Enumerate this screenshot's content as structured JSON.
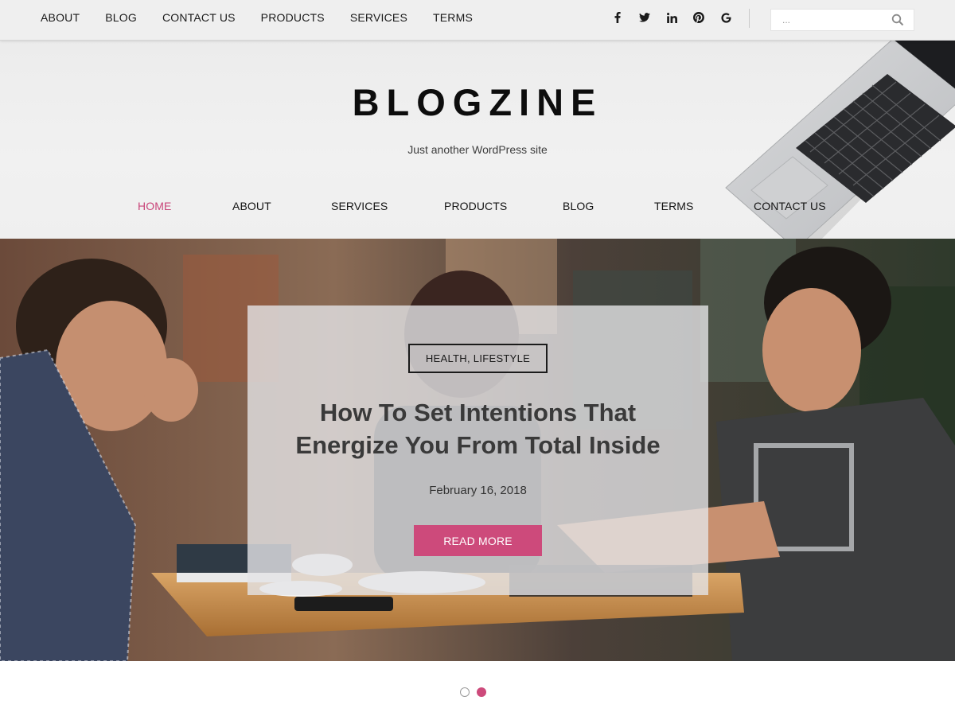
{
  "top_menu": {
    "items": [
      {
        "label": "ABOUT"
      },
      {
        "label": "BLOG"
      },
      {
        "label": "CONTACT US"
      },
      {
        "label": "PRODUCTS"
      },
      {
        "label": "SERVICES"
      },
      {
        "label": "TERMS"
      }
    ]
  },
  "social": {
    "icons": [
      "facebook-icon",
      "twitter-icon",
      "linkedin-icon",
      "pinterest-icon",
      "google-icon"
    ]
  },
  "search": {
    "placeholder": "..."
  },
  "site": {
    "title": "BLOGZINE",
    "tagline": "Just another WordPress site"
  },
  "main_nav": {
    "items": [
      {
        "label": "HOME",
        "active": true
      },
      {
        "label": "ABOUT"
      },
      {
        "label": "SERVICES"
      },
      {
        "label": "PRODUCTS"
      },
      {
        "label": "BLOG"
      },
      {
        "label": "TERMS"
      },
      {
        "label": "CONTACT US"
      }
    ]
  },
  "slide": {
    "category": "HEALTH, LIFESTYLE",
    "title_line1": "How To Set Intentions That",
    "title_line2": "Energize You From Total Inside",
    "date": "February 16, 2018",
    "read_more": "READ MORE"
  },
  "slider": {
    "dot_count": 2,
    "active_index": 1
  },
  "colors": {
    "accent": "#cd4a7b",
    "topbar_bg": "#efefef",
    "header_bg": "#ececec"
  }
}
